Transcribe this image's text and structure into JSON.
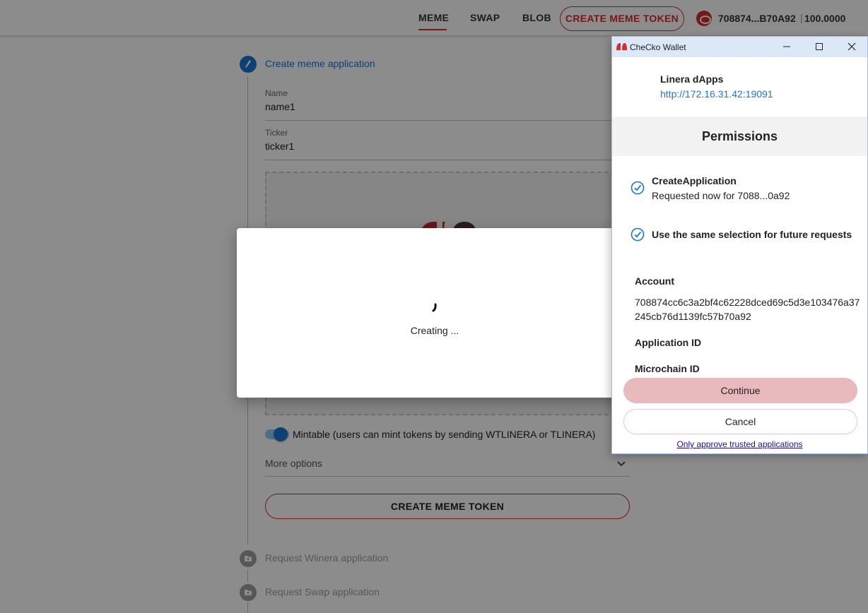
{
  "nav": {
    "tabs": [
      {
        "label": "MEME",
        "active": true
      },
      {
        "label": "SWAP",
        "active": false
      },
      {
        "label": "BLOB",
        "active": false
      }
    ],
    "create_button": "CREATE MEME TOKEN",
    "account": {
      "address": "708874...B70A92",
      "separator": "|",
      "balance": "100.0000",
      "icon": "coin-icon"
    }
  },
  "form": {
    "steps": [
      {
        "title": "Create meme application",
        "state": "active",
        "icon": "pencil-icon"
      },
      {
        "title": "Request Wlinera application",
        "state": "pending",
        "icon": "folder-icon"
      },
      {
        "title": "Request Swap application",
        "state": "pending",
        "icon": "folder-icon"
      }
    ],
    "name_label": "Name",
    "name_value": "name1",
    "ticker_label": "Ticker",
    "ticker_value": "ticker1",
    "mintable_label": "Mintable (users can mint tokens by sending WTLINERA or TLINERA)",
    "mintable_on": true,
    "more_options": "More options",
    "submit": "CREATE MEME TOKEN"
  },
  "modal": {
    "status_text": "Creating ..."
  },
  "wallet": {
    "window_title": "CheCko Wallet",
    "dapp_name": "Linera dApps",
    "dapp_url": "http://172.16.31.42:19091",
    "permissions_title": "Permissions",
    "permission": {
      "name": "CreateApplication",
      "detail": "Requested now for 7088...0a92"
    },
    "same_selection": "Use the same selection for future requests",
    "account_label": "Account",
    "account_value": "708874cc6c3a2bf4c62228dced69c5d3e103476a37245cb76d1139fc57b70a92",
    "application_id_label": "Application ID",
    "microchain_id_label": "Microchain ID",
    "continue": "Continue",
    "cancel": "Cancel",
    "trusted_link": "Only approve trusted applications"
  },
  "colors": {
    "brand_red": "#d32f2f",
    "accent_blue": "#1976d2",
    "continue_pink": "#e8b9bd"
  }
}
